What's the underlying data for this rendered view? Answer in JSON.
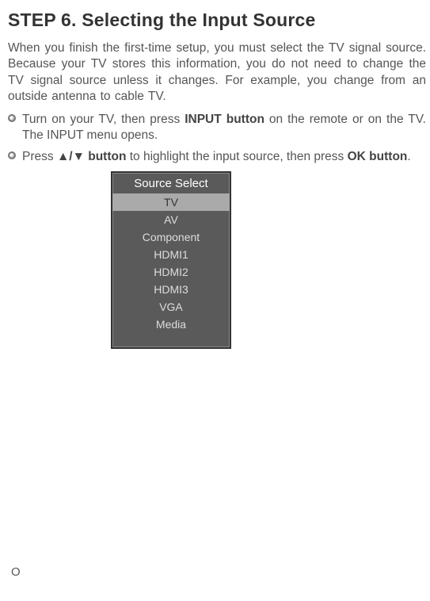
{
  "title": "STEP 6. Selecting the Input Source",
  "intro": "When you finish the first-time setup, you must select the TV signal source. Because your TV stores this information, you do not need to change the TV signal source unless it changes. For example, you change from an outside antenna to cable TV.",
  "bullets": [
    {
      "prefix": "Turn on your TV, then press ",
      "bold1": "INPUT button",
      "middle": " on the remote or on the TV. The INPUT menu opens.",
      "bold2": "",
      "suffix": ""
    },
    {
      "prefix": "Press ",
      "bold1": "▲/▼ button",
      "middle": " to highlight the input source, then press ",
      "bold2": "OK button",
      "suffix": "."
    }
  ],
  "source_menu": {
    "title": "Source Select",
    "items": [
      {
        "label": "TV",
        "selected": true
      },
      {
        "label": "AV",
        "selected": false
      },
      {
        "label": "Component",
        "selected": false
      },
      {
        "label": "HDMI1",
        "selected": false
      },
      {
        "label": "HDMI2",
        "selected": false
      },
      {
        "label": "HDMI3",
        "selected": false
      },
      {
        "label": "VGA",
        "selected": false
      },
      {
        "label": "Media",
        "selected": false
      }
    ]
  },
  "footer_letter": "O"
}
